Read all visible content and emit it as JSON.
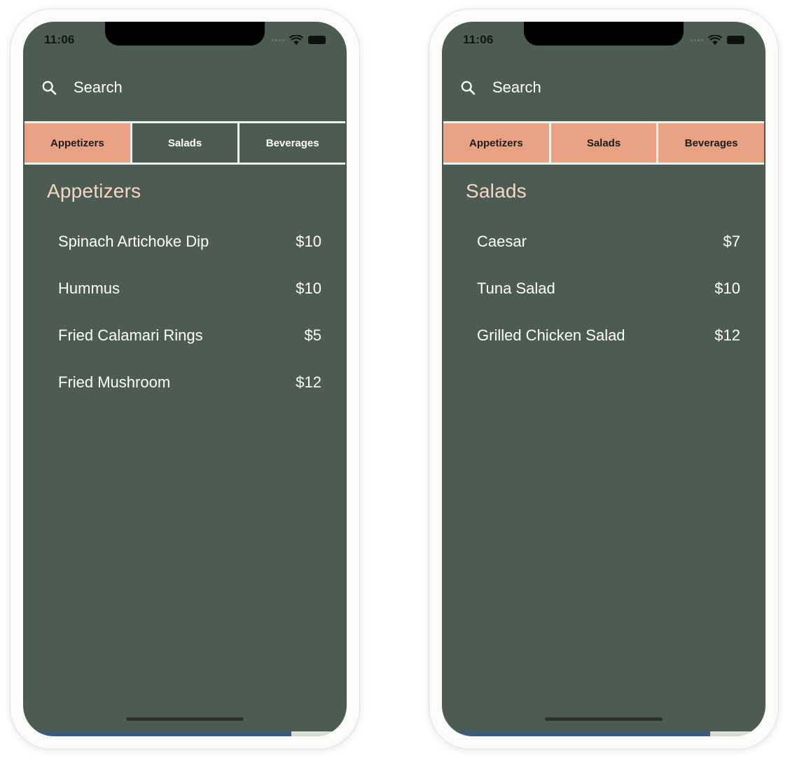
{
  "background_color": "#ffffff",
  "theme": {
    "screen_bg": "#4c5c52",
    "accent": "#e8a183",
    "section_title_color": "#f6d6c2",
    "text_color": "#ffffff",
    "frame_color": "#fbfbfa",
    "tab_border_color": "#eef0ee",
    "home_indicator_color": "#2e3331",
    "scrollbar_thumb_color": "#3d5a7a"
  },
  "phones": [
    {
      "id": "left",
      "status_bar": {
        "time": "11:06",
        "signal_icon": "signal-dots-icon",
        "wifi_icon": "wifi-icon",
        "battery_icon": "battery-full-icon"
      },
      "search": {
        "icon": "search-icon",
        "placeholder": "Search",
        "value": ""
      },
      "tabs": [
        {
          "label": "Appetizers",
          "active": true
        },
        {
          "label": "Salads",
          "active": false
        },
        {
          "label": "Beverages",
          "active": false
        }
      ],
      "section": {
        "title": "Appetizers",
        "items": [
          {
            "name": "Spinach Artichoke Dip",
            "price": "$10"
          },
          {
            "name": "Hummus",
            "price": "$10"
          },
          {
            "name": "Fried Calamari Rings",
            "price": "$5"
          },
          {
            "name": "Fried Mushroom",
            "price": "$12"
          }
        ]
      }
    },
    {
      "id": "right",
      "status_bar": {
        "time": "11:06",
        "signal_icon": "signal-dots-icon",
        "wifi_icon": "wifi-icon",
        "battery_icon": "battery-full-icon"
      },
      "search": {
        "icon": "search-icon",
        "placeholder": "Search",
        "value": ""
      },
      "tabs": [
        {
          "label": "Appetizers",
          "active": true
        },
        {
          "label": "Salads",
          "active": true
        },
        {
          "label": "Beverages",
          "active": true
        }
      ],
      "section": {
        "title": "Salads",
        "items": [
          {
            "name": "Caesar",
            "price": "$7"
          },
          {
            "name": "Tuna Salad",
            "price": "$10"
          },
          {
            "name": "Grilled Chicken Salad",
            "price": "$12"
          }
        ]
      }
    }
  ]
}
